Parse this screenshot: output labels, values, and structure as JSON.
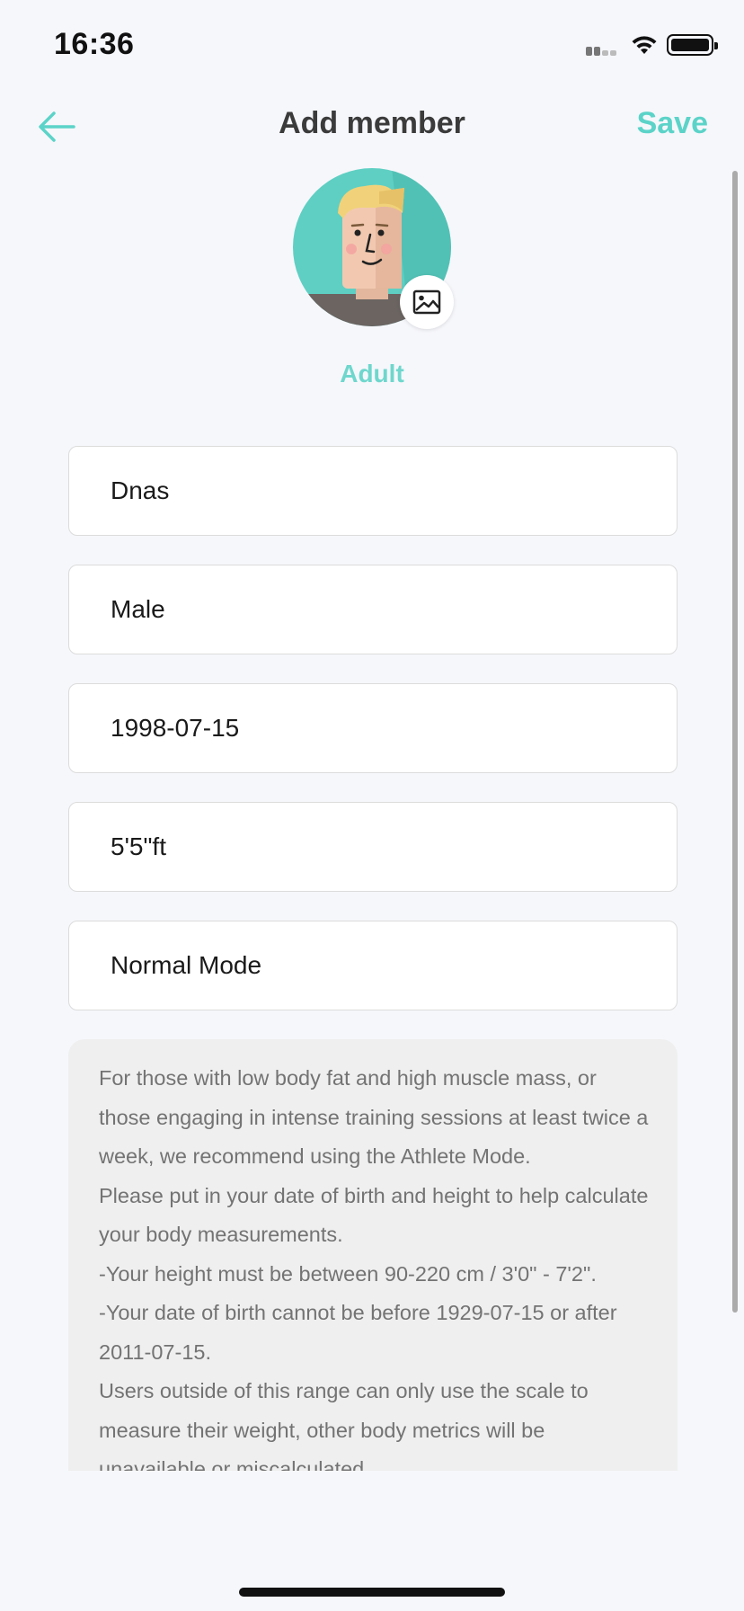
{
  "status_bar": {
    "time": "16:36"
  },
  "nav": {
    "title": "Add member",
    "save_label": "Save"
  },
  "profile": {
    "category": "Adult"
  },
  "fields": {
    "name": "Dnas",
    "gender": "Male",
    "birthday": "1998-07-15",
    "height": "5'5\"ft",
    "mode": "Normal Mode"
  },
  "info": {
    "p1": "For those with low body fat and high muscle mass, or those engaging in intense training sessions at least twice a week, we recommend using the Athlete Mode.",
    "p2": "Please put in your date of birth and height to help calculate your body measurements.",
    "p3": "-Your height must be between 90-220 cm / 3'0\" - 7'2\".",
    "p4": "-Your date of birth cannot be before 1929-07-15 or after 2011-07-15.",
    "p5": "Users outside of this range can only use the scale to measure their weight, other body metrics will be unavailable or miscalculated."
  },
  "colors": {
    "accent": "#5cd3c8",
    "background": "#f6f7fb",
    "info_box": "#efefef"
  },
  "icons": [
    "back-arrow-icon",
    "image-icon",
    "wifi-icon",
    "battery-icon",
    "signal-icon"
  ]
}
